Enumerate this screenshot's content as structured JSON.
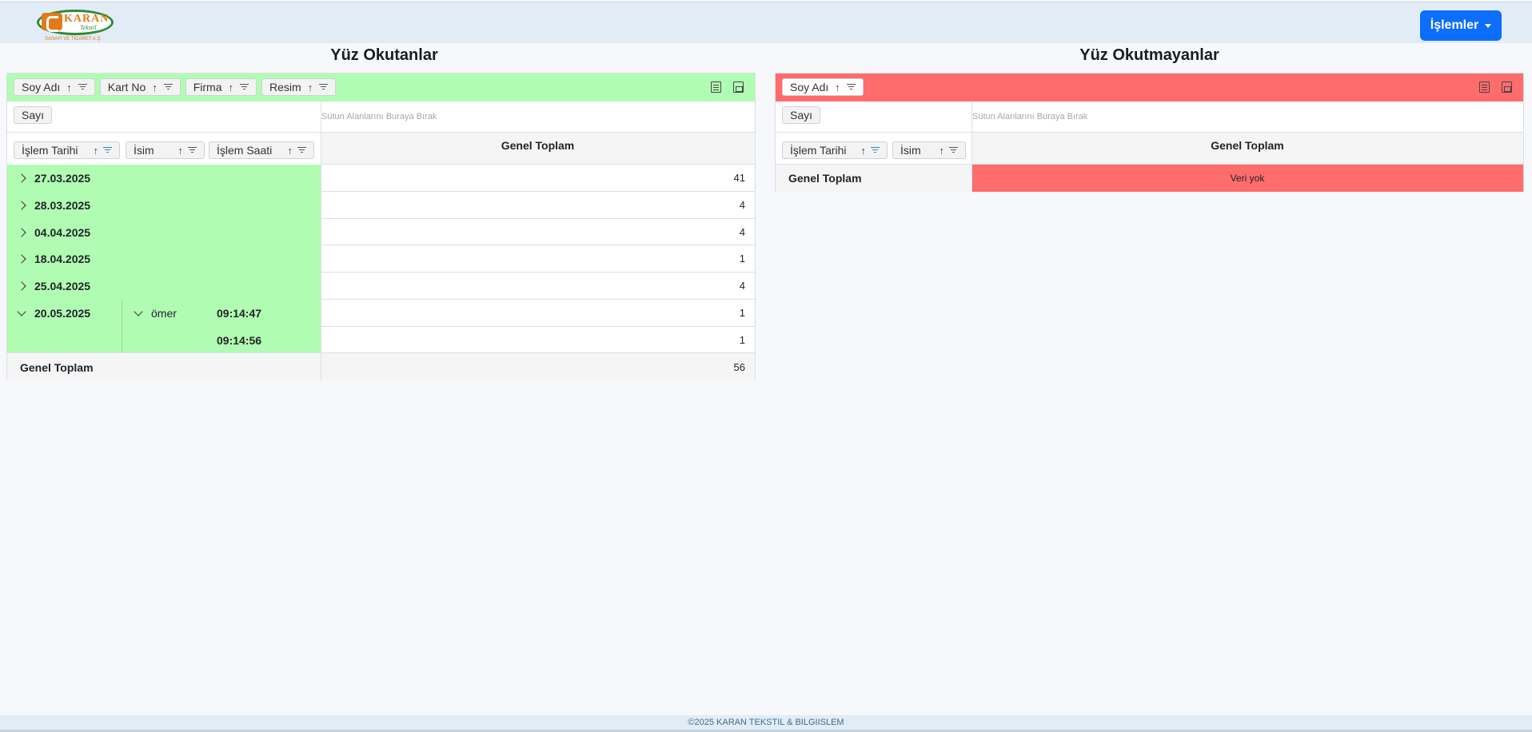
{
  "logo": {
    "word": "KARAN",
    "script": "Tekstil",
    "subtitle": "SANAYİ VE TİCARET A.Ş."
  },
  "header": {
    "menu_label": "İşlemler"
  },
  "colors": {
    "green": "#b1fcb3",
    "red": "#fe6c6c",
    "primary": "#0d6efd"
  },
  "left": {
    "title": "Yüz Okutanlar",
    "filter_fields": [
      "Soy Adı",
      "Kart No",
      "Firma",
      "Resim"
    ],
    "data_field": "Sayı",
    "drop_hint": "Sütun Alanlarını Buraya Bırak",
    "row_fields": [
      "İşlem Tarihi",
      "İsim",
      "İşlem Saati"
    ],
    "column_header": "Genel Toplam",
    "rows": [
      {
        "date": "27.03.2025",
        "name": "",
        "time": "",
        "value": "41"
      },
      {
        "date": "28.03.2025",
        "name": "",
        "time": "",
        "value": "4"
      },
      {
        "date": "04.04.2025",
        "name": "",
        "time": "",
        "value": "4"
      },
      {
        "date": "18.04.2025",
        "name": "",
        "time": "",
        "value": "1"
      },
      {
        "date": "25.04.2025",
        "name": "",
        "time": "",
        "value": "4"
      },
      {
        "date": "20.05.2025",
        "name": "ömer",
        "time": "09:14:47",
        "value": "1"
      },
      {
        "date": "",
        "name": "",
        "time": "09:14:56",
        "value": "1"
      }
    ],
    "grand_total_label": "Genel Toplam",
    "grand_total_value": "56"
  },
  "right": {
    "title": "Yüz Okutmayanlar",
    "filter_fields": [
      "Soy Adı"
    ],
    "data_field": "Sayı",
    "drop_hint": "Sütun Alanlarını Buraya Bırak",
    "row_fields": [
      "İşlem Tarihi",
      "İsim"
    ],
    "column_header": "Genel Toplam",
    "grand_total_label": "Genel Toplam",
    "no_data": "Veri yok"
  },
  "footer": {
    "text": "©2025 KARAN TEKSTIL & BILGIISLEM"
  }
}
